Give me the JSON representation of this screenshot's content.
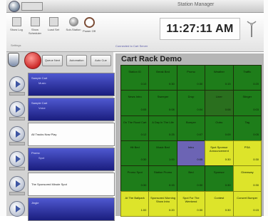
{
  "window": {
    "title": "Station Manager"
  },
  "ribbon": {
    "buttons": [
      {
        "label": "Show Log",
        "icon": "log-icon"
      },
      {
        "label": "Show Scheduler",
        "icon": "scheduler-icon"
      },
      {
        "label": "Load Set",
        "icon": "folder-icon"
      },
      {
        "label": "Sub-Station",
        "icon": "station-icon"
      },
      {
        "label": "Power Off",
        "icon": "power-icon"
      }
    ],
    "group_label": "Settings",
    "clock": "11:27:11 AM"
  },
  "status_line": "Connected to Cart Server",
  "left": {
    "buttons": [
      "Queue Next",
      "Automation",
      "Auto Cue"
    ],
    "carts": [
      {
        "title": "Sample Cart",
        "subtitle": "Music",
        "style": "blue"
      },
      {
        "title": "Sample Cart",
        "subtitle": "Voice",
        "style": "blue"
      },
      {
        "title": "All Tracks Now Play",
        "subtitle": "",
        "style": "white"
      },
      {
        "title": "Promo",
        "subtitle": "Spot",
        "style": "blue"
      },
      {
        "title": "The Sponsored Minute Spot",
        "subtitle": "",
        "style": "white"
      },
      {
        "title": "Jingle",
        "subtitle": "",
        "style": "blue"
      }
    ]
  },
  "rack": {
    "title": "Cart Rack Demo",
    "tiles": [
      {
        "t1": "Station ID",
        "t2": "0:10",
        "color": "green"
      },
      {
        "t1": "Break Bed",
        "t2": "0:30",
        "color": "green"
      },
      {
        "t1": "Promo",
        "t2": "0:30",
        "color": "green"
      },
      {
        "t1": "Weather",
        "t2": "0:15",
        "color": "green"
      },
      {
        "t1": "Traffic",
        "t2": "0:20",
        "color": "green"
      },
      {
        "t1": "News Intro",
        "t2": "0:05",
        "color": "green"
      },
      {
        "t1": "Sweeper",
        "t2": "0:08",
        "color": "green"
      },
      {
        "t1": "Drop",
        "t2": "0:04",
        "color": "green"
      },
      {
        "t1": "Liner",
        "t2": "0:06",
        "color": "green",
        "selected": true
      },
      {
        "t1": "Stinger",
        "t2": "0:03",
        "color": "green"
      },
      {
        "t1": "On The Road Cart",
        "t2": "0:12",
        "color": "green"
      },
      {
        "t1": "A Day In The Life",
        "t2": "0:25",
        "color": "green"
      },
      {
        "t1": "Bumper",
        "t2": "0:07",
        "color": "green"
      },
      {
        "t1": "Outro",
        "t2": "0:09",
        "color": "green"
      },
      {
        "t1": "Tag",
        "t2": "0:05",
        "color": "green"
      },
      {
        "t1": "Hit Bed",
        "t2": "0:30",
        "color": "green"
      },
      {
        "t1": "Music Bed",
        "t2": "1:00",
        "color": "green"
      },
      {
        "t1": "Intro",
        "t2": "0:05",
        "color": "purple"
      },
      {
        "t1": "Spot Sponsor Announcement",
        "t2": "0:30",
        "color": "yellow"
      },
      {
        "t1": "PSA",
        "t2": "0:30",
        "color": "yellow"
      },
      {
        "t1": "Promo Spot",
        "t2": "0:30",
        "color": "green"
      },
      {
        "t1": "Station Promo",
        "t2": "0:15",
        "color": "green"
      },
      {
        "t1": "Bed",
        "t2": "0:30",
        "color": "green"
      },
      {
        "t1": "Sponsor",
        "t2": "0:30",
        "color": "green"
      },
      {
        "t1": "Giveaway",
        "t2": "0:30",
        "color": "yellow"
      },
      {
        "t1": "At The Ballpark",
        "t2": "1:00",
        "color": "yellow"
      },
      {
        "t1": "Sponsored Morning Show Intro",
        "t2": "0:20",
        "color": "yellow"
      },
      {
        "t1": "Spot For The Weekend",
        "t2": "0:30",
        "color": "yellow"
      },
      {
        "t1": "Contest",
        "t2": "0:30",
        "color": "yellow"
      },
      {
        "t1": "Concert Bumper",
        "t2": "0:15",
        "color": "yellow"
      }
    ]
  }
}
